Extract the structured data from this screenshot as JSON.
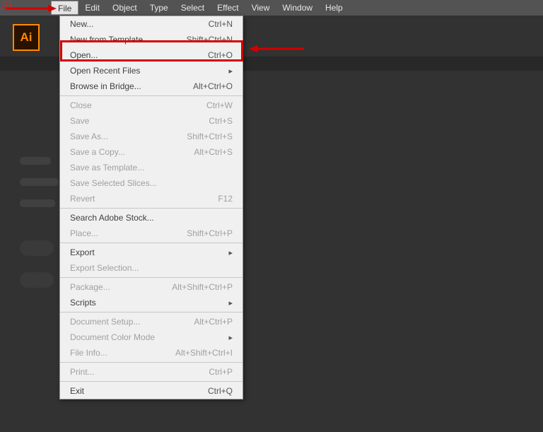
{
  "app": {
    "logo_text": "Ai",
    "ai_logo": "Ai"
  },
  "menubar": {
    "items": [
      "File",
      "Edit",
      "Object",
      "Type",
      "Select",
      "Effect",
      "View",
      "Window",
      "Help"
    ],
    "active_index": 0
  },
  "dropdown": {
    "sections": [
      [
        {
          "label": "New...",
          "shortcut": "Ctrl+N"
        },
        {
          "label": "New from Template...",
          "shortcut": "Shift+Ctrl+N"
        },
        {
          "label": "Open...",
          "shortcut": "Ctrl+O",
          "highlighted": true
        },
        {
          "label": "Open Recent Files",
          "submenu": true
        },
        {
          "label": "Browse in Bridge...",
          "shortcut": "Alt+Ctrl+O"
        }
      ],
      [
        {
          "label": "Close",
          "shortcut": "Ctrl+W",
          "disabled": true
        },
        {
          "label": "Save",
          "shortcut": "Ctrl+S",
          "disabled": true
        },
        {
          "label": "Save As...",
          "shortcut": "Shift+Ctrl+S",
          "disabled": true
        },
        {
          "label": "Save a Copy...",
          "shortcut": "Alt+Ctrl+S",
          "disabled": true
        },
        {
          "label": "Save as Template...",
          "disabled": true
        },
        {
          "label": "Save Selected Slices...",
          "disabled": true
        },
        {
          "label": "Revert",
          "shortcut": "F12",
          "disabled": true
        }
      ],
      [
        {
          "label": "Search Adobe Stock..."
        },
        {
          "label": "Place...",
          "shortcut": "Shift+Ctrl+P",
          "disabled": true
        }
      ],
      [
        {
          "label": "Export",
          "submenu": true
        },
        {
          "label": "Export Selection...",
          "disabled": true
        }
      ],
      [
        {
          "label": "Package...",
          "shortcut": "Alt+Shift+Ctrl+P",
          "disabled": true
        },
        {
          "label": "Scripts",
          "submenu": true
        }
      ],
      [
        {
          "label": "Document Setup...",
          "shortcut": "Alt+Ctrl+P",
          "disabled": true
        },
        {
          "label": "Document Color Mode",
          "submenu": true,
          "disabled": true
        },
        {
          "label": "File Info...",
          "shortcut": "Alt+Shift+Ctrl+I",
          "disabled": true
        }
      ],
      [
        {
          "label": "Print...",
          "shortcut": "Ctrl+P",
          "disabled": true
        }
      ],
      [
        {
          "label": "Exit",
          "shortcut": "Ctrl+Q"
        }
      ]
    ]
  },
  "annotations": {
    "arrow1": "→",
    "arrow2": "←"
  }
}
